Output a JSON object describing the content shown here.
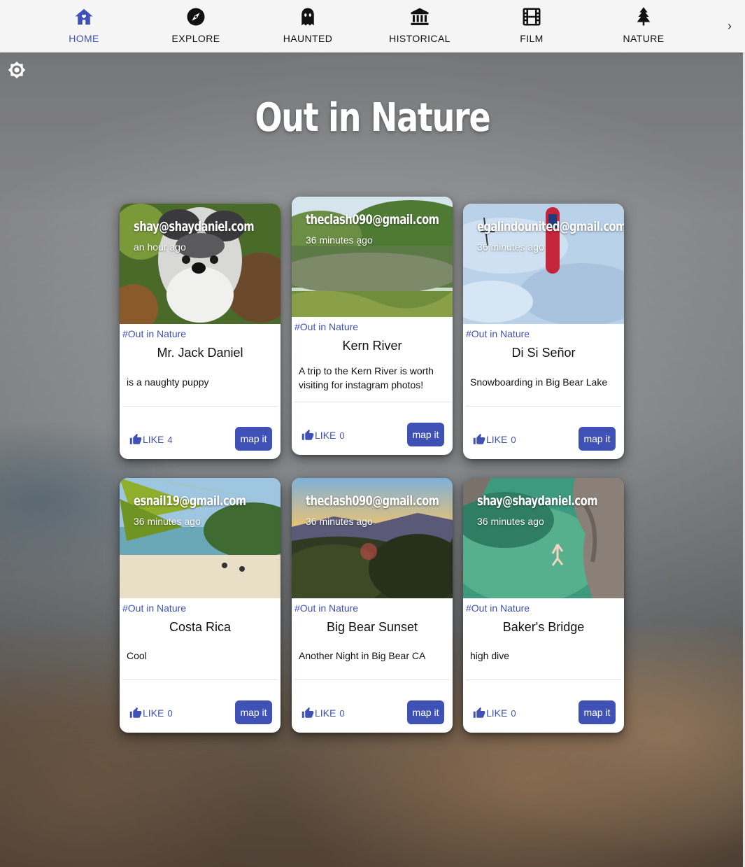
{
  "nav": {
    "items": [
      {
        "label": "HOME",
        "icon": "home-icon",
        "active": true
      },
      {
        "label": "EXPLORE",
        "icon": "compass-icon",
        "active": false
      },
      {
        "label": "HAUNTED",
        "icon": "ghost-icon",
        "active": false
      },
      {
        "label": "HISTORICAL",
        "icon": "museum-icon",
        "active": false
      },
      {
        "label": "FILM",
        "icon": "film-icon",
        "active": false
      },
      {
        "label": "NATURE",
        "icon": "tree-icon",
        "active": false
      }
    ],
    "next_glyph": "›"
  },
  "page": {
    "title": "Out in Nature",
    "theme_icon": "brightness-icon"
  },
  "colors": {
    "accent": "#3f51b5",
    "nav_bg": "#f5f5f5",
    "card_bg": "#ffffff"
  },
  "posts": [
    {
      "author": "shay@shaydaniel.com",
      "time": "an hour ago",
      "tag": "#Out in Nature",
      "title": "Mr. Jack Daniel",
      "description": "is a naughty puppy",
      "like_label": "LIKE",
      "likes": "4",
      "map_label": "map it",
      "image": "schnauzer-dog-photo"
    },
    {
      "author": "theclash090@gmail.com",
      "time": "36 minutes ago",
      "tag": "#Out in Nature",
      "title": "Kern River",
      "description": "A trip to the Kern River is worth visiting for instagram photos!",
      "like_label": "LIKE",
      "likes": "0",
      "map_label": "map it",
      "image": "river-photo"
    },
    {
      "author": "egalindounited@gmail.com",
      "time": "36 minutes ago",
      "tag": "#Out in Nature",
      "title": "Di Si Señor",
      "description": "Snowboarding in Big Bear Lake",
      "like_label": "LIKE",
      "likes": "0",
      "map_label": "map it",
      "image": "snowboard-photo"
    },
    {
      "author": "esnail19@gmail.com",
      "time": "36 minutes ago",
      "tag": "#Out in Nature",
      "title": "Costa Rica",
      "description": "Cool",
      "like_label": "LIKE",
      "likes": "0",
      "map_label": "map it",
      "image": "beach-photo"
    },
    {
      "author": "theclash090@gmail.com",
      "time": "36 minutes ago",
      "tag": "#Out in Nature",
      "title": "Big Bear Sunset",
      "description": "Another Night in Big Bear CA",
      "like_label": "LIKE",
      "likes": "0",
      "map_label": "map it",
      "image": "sunset-photo"
    },
    {
      "author": "shay@shaydaniel.com",
      "time": "36 minutes ago",
      "tag": "#Out in Nature",
      "title": "Baker's Bridge",
      "description": "high dive",
      "like_label": "LIKE",
      "likes": "0",
      "map_label": "map it",
      "image": "cliff-dive-photo"
    }
  ]
}
